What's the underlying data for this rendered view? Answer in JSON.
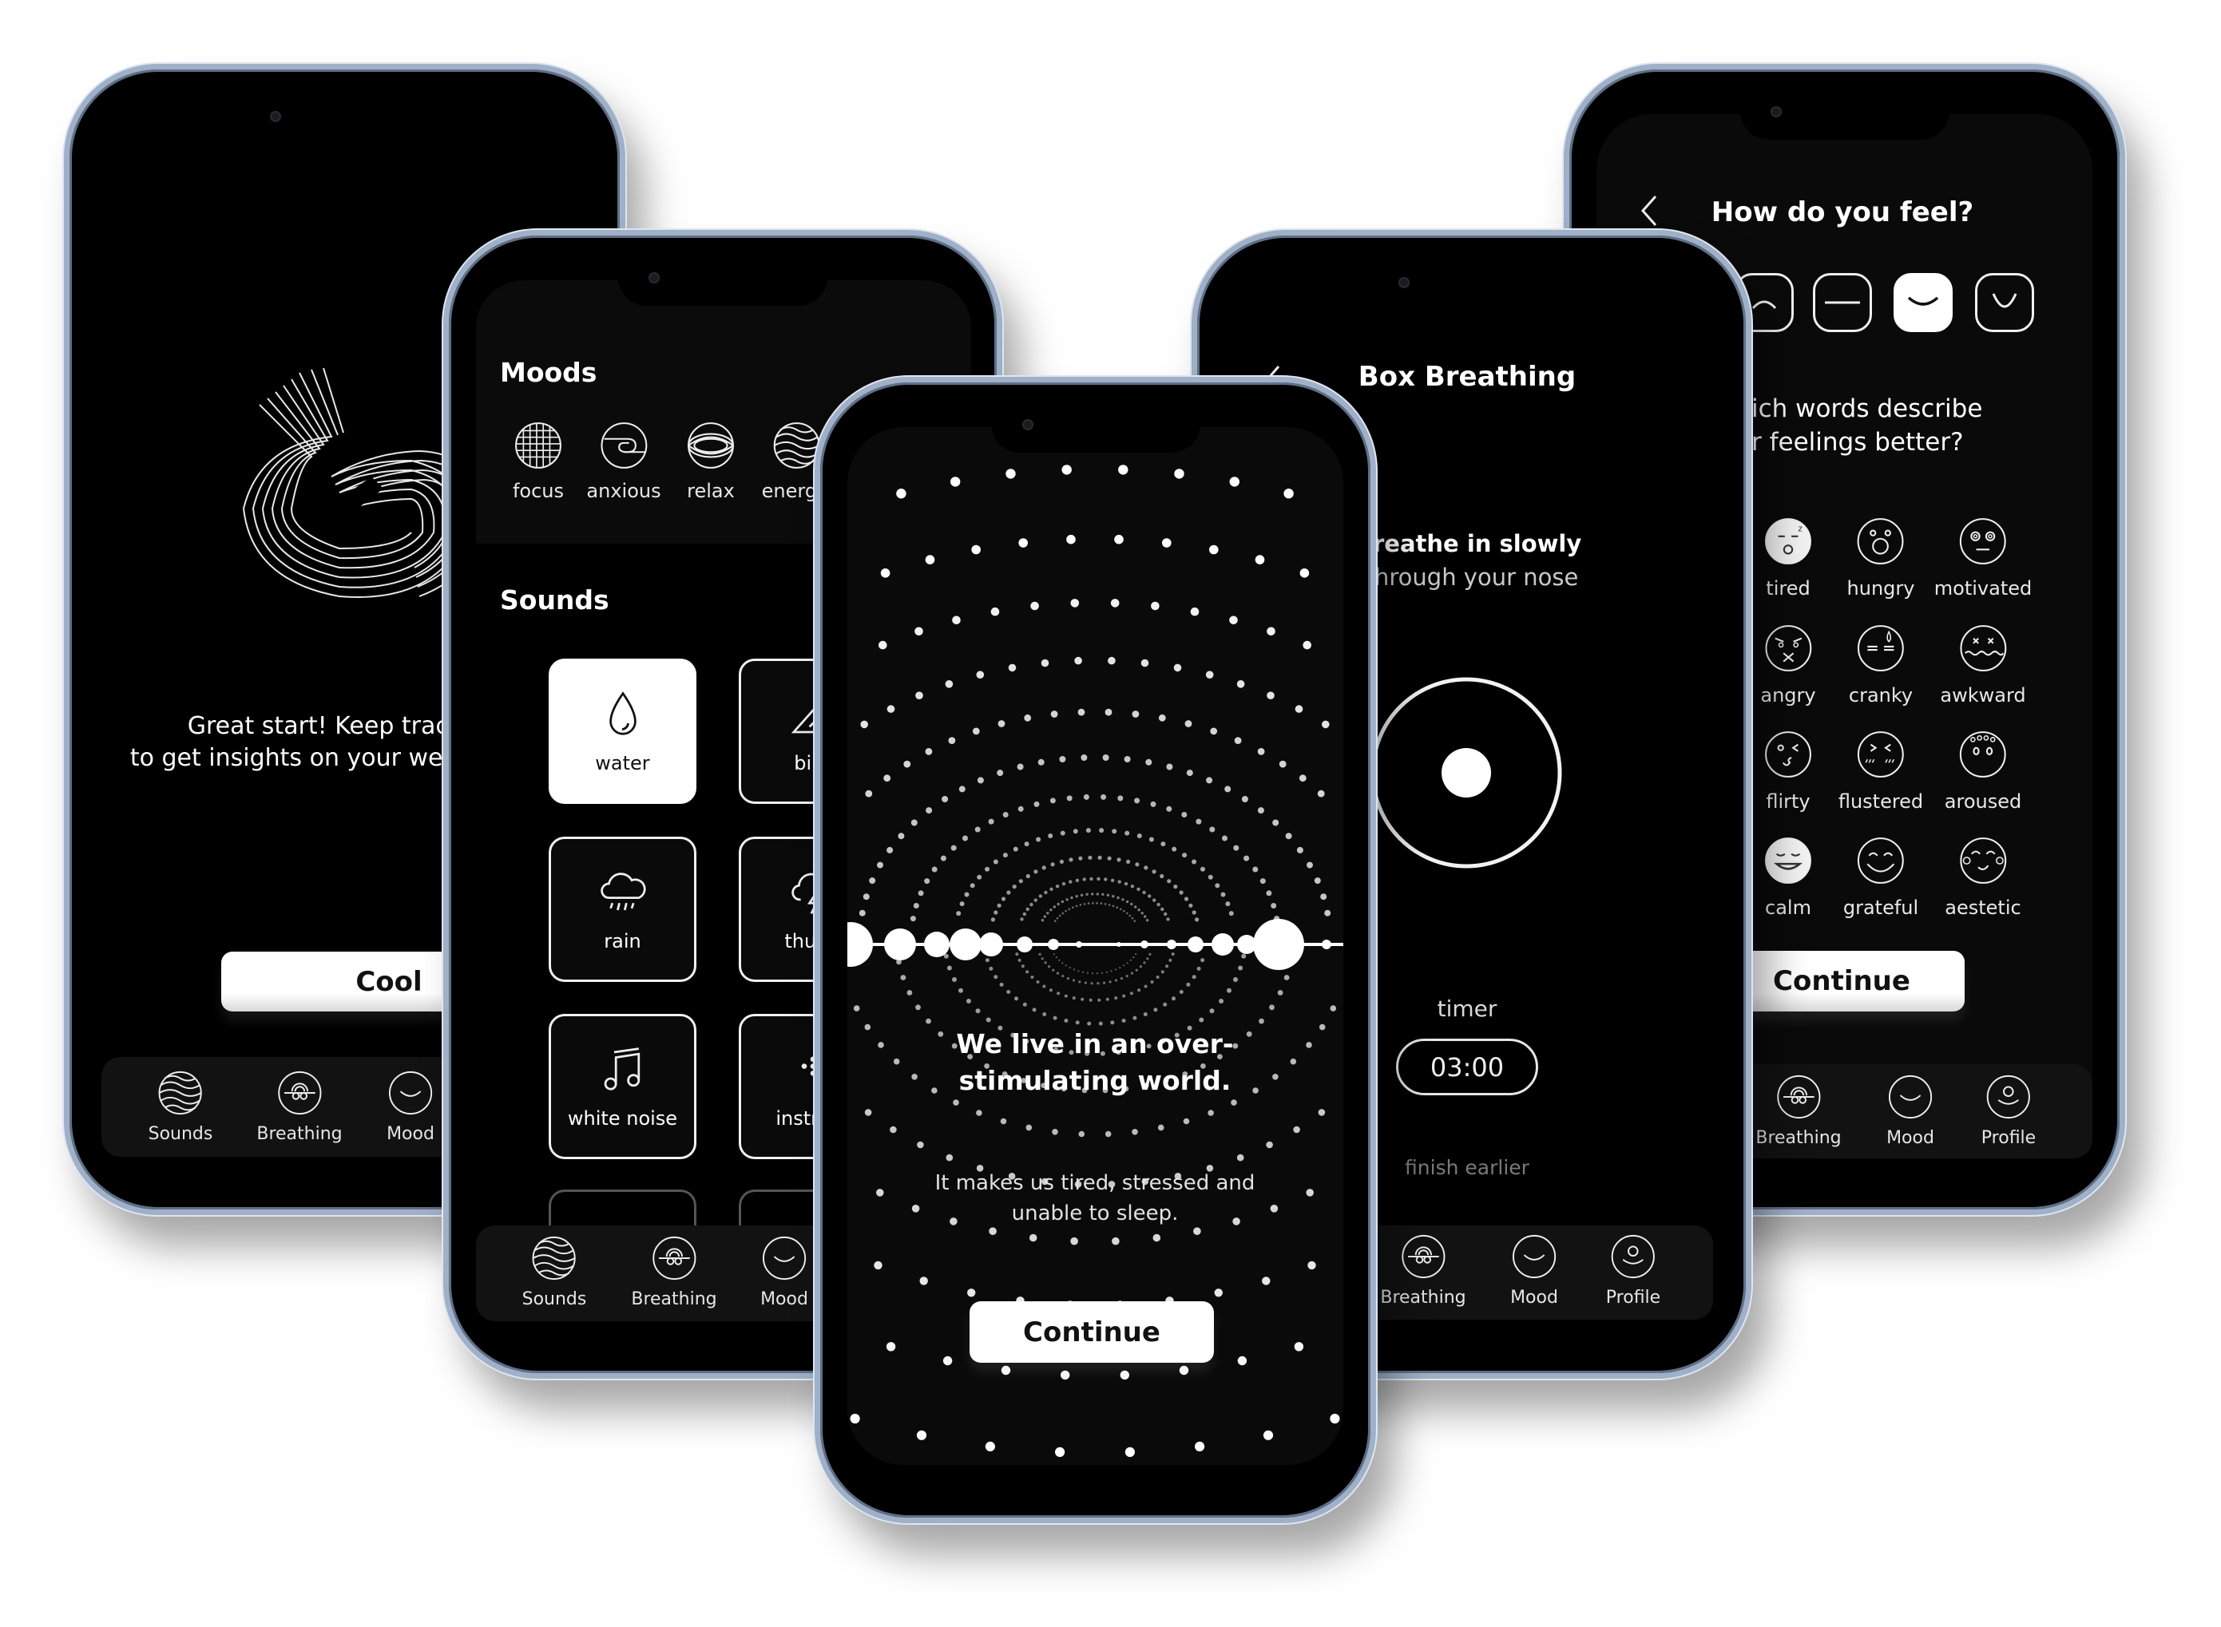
{
  "phones": {
    "onboarding_done": {
      "message_line1": "Great start! Keep track",
      "message_line2": "to get insights on your well",
      "button_label": "Cool",
      "nav": [
        {
          "label": "Sounds",
          "icon": "sounds-icon"
        },
        {
          "label": "Breathing",
          "icon": "breathing-icon"
        },
        {
          "label": "Mood",
          "icon": "mood-icon"
        }
      ]
    },
    "sounds_screen": {
      "moods_title": "Moods",
      "moods": [
        {
          "label": "focus",
          "icon": "focus-icon"
        },
        {
          "label": "anxious",
          "icon": "anxious-icon"
        },
        {
          "label": "relax",
          "icon": "relax-icon"
        },
        {
          "label": "energiz",
          "icon": "energize-icon"
        }
      ],
      "sounds_title": "Sounds",
      "sounds": [
        {
          "label": "water",
          "icon": "water-drop-icon",
          "selected": true
        },
        {
          "label": "bird",
          "icon": "bird-icon",
          "selected": false
        },
        {
          "label": "rain",
          "icon": "rain-cloud-icon",
          "selected": false
        },
        {
          "label": "thund",
          "icon": "thunder-cloud-icon",
          "selected": false
        },
        {
          "label": "white noise",
          "icon": "music-note-icon",
          "selected": false
        },
        {
          "label": "instrum",
          "icon": "dots-icon",
          "selected": false
        }
      ],
      "nav": [
        {
          "label": "Sounds",
          "icon": "sounds-icon"
        },
        {
          "label": "Breathing",
          "icon": "breathing-icon"
        },
        {
          "label": "Mood",
          "icon": "mood-icon"
        }
      ]
    },
    "intro": {
      "heading_line1": "We live in an over-",
      "heading_line2": "stimulating world.",
      "sub_line1": "It makes us tired, stressed and",
      "sub_line2": "unable to sleep.",
      "button_label": "Continue"
    },
    "box_breathing": {
      "title": "Box Breathing",
      "instruction": "reathe in slowly",
      "instruction_sub": "hrough your nose",
      "timer_label": "timer",
      "timer_value": "03:00",
      "finish_label": "finish earlier",
      "nav": [
        {
          "label": "Breathing",
          "icon": "breathing-icon"
        },
        {
          "label": "Mood",
          "icon": "mood-icon"
        },
        {
          "label": "Profile",
          "icon": "profile-icon"
        }
      ]
    },
    "mood_check": {
      "title": "How do you feel?",
      "face_scale": [
        {
          "icon": "frown-face-icon",
          "selected": false
        },
        {
          "icon": "neutral-face-icon",
          "selected": false
        },
        {
          "icon": "slight-smile-face-icon",
          "selected": true
        },
        {
          "icon": "big-smile-face-icon",
          "selected": false
        }
      ],
      "question_line1": "ich words describe",
      "question_line2": "r feelings better?",
      "emotions": [
        {
          "label": "tired",
          "selected": true
        },
        {
          "label": "hungry",
          "selected": false
        },
        {
          "label": "motivated",
          "selected": false
        },
        {
          "label": "angry",
          "selected": false
        },
        {
          "label": "cranky",
          "selected": false
        },
        {
          "label": "awkward",
          "selected": false
        },
        {
          "label": "flirty",
          "selected": false
        },
        {
          "label": "flustered",
          "selected": false
        },
        {
          "label": "aroused",
          "selected": false
        },
        {
          "label": "calm",
          "selected": true
        },
        {
          "label": "grateful",
          "selected": false
        },
        {
          "label": "aestetic",
          "selected": false
        }
      ],
      "button_label": "Continue",
      "nav": [
        {
          "label": "Breathing",
          "icon": "breathing-icon"
        },
        {
          "label": "Mood",
          "icon": "mood-icon"
        },
        {
          "label": "Profile",
          "icon": "profile-icon"
        }
      ]
    }
  },
  "colors": {
    "background": "#ffffff",
    "screen": "#0a0a0a",
    "frame": "#9fb0c8",
    "accent": "#ffffff"
  }
}
